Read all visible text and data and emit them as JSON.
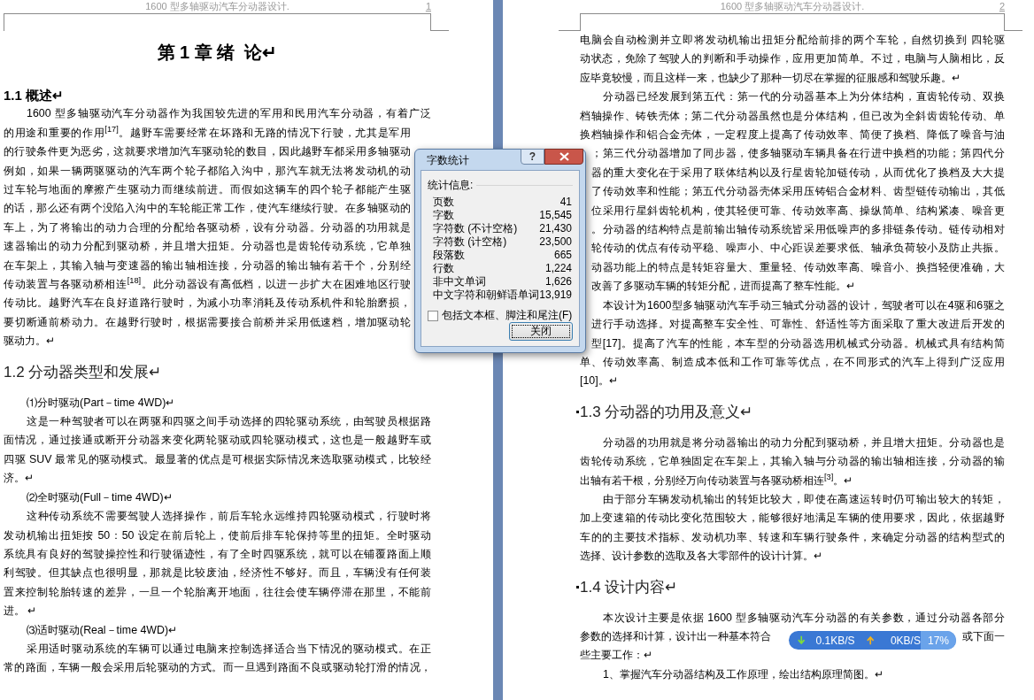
{
  "pages": [
    {
      "header": "1600 型多轴驱动汽车分动器设计.",
      "page_number": "1",
      "blocks": [
        {
          "kind": "chapter_title",
          "text": "第 1 章 绪  论↵"
        },
        {
          "kind": "section_title",
          "text": "1.1 概述↵"
        },
        {
          "kind": "first",
          "text": "1600 型多轴驱动汽车分动器作为我国较先进的军用和民用汽车分动器，有着广泛"
        },
        {
          "kind": "cut_end",
          "text": "的用途和重要的作用$^{[17]}$。越野车需要经常在坏路和无路的情况下行驶，尤其是军用"
        },
        {
          "kind": "cut_end",
          "text": "的行驶条件更为恶劣，这就要求增加汽车驱动轮的数目，因此越野车都采用多轴驱动"
        },
        {
          "kind": "cut_end",
          "text": "例如，如果一辆两驱驱动的汽车两个轮子都陷入沟中，那汽车就无法将发动机的动"
        },
        {
          "kind": "cut_end",
          "text": "过车轮与地面的摩擦产生驱动力而继续前进。而假如这辆车的四个轮子都能产生驱"
        },
        {
          "kind": "cut_end",
          "text": "的话，那么还有两个没陷入沟中的车轮能正常工作，使汽车继续行驶。在多轴驱动的"
        },
        {
          "kind": "cut_end",
          "text": "车上，为了将输出的动力合理的分配给各驱动桥，设有分动器。分动器的功用就是"
        },
        {
          "kind": "cut_end",
          "text": "速器输出的动力分配到驱动桥，并且增大扭矩。分动器也是齿轮传动系统，它单独"
        },
        {
          "kind": "cut_end",
          "text": "在车架上，其输入轴与变速器的输出轴相连接，分动器的输出轴有若干个，分别经"
        },
        {
          "kind": "cut_end",
          "text": "传动装置与各驱动桥相连$^{[18]}$。此分动器设有高低档，以进一步扩大在困难地区行驶"
        },
        {
          "kind": "cut_end",
          "text": "传动比。越野汽车在良好道路行驶时，为减小功率消耗及传动系机件和轮胎磨损，"
        },
        {
          "kind": "cut_end",
          "text": "要切断通前桥动力。在越野行驶时，根据需要接合前桥并采用低速档，增加驱动轮"
        },
        {
          "kind": "end",
          "text": "驱动力。↵"
        },
        {
          "kind": "heading",
          "text": "1.2 分动器类型和发展↵",
          "bullet": false
        },
        {
          "kind": "item",
          "text": "⑴分时驱动(Part－time 4WD)↵"
        },
        {
          "kind": "first",
          "text": "这是一种驾驶者可以在两驱和四驱之间手动选择的四轮驱动系统，由驾驶员根据路"
        },
        {
          "kind": "line",
          "text": "面情况，通过接通或断开分动器来变化两轮驱动或四轮驱动模式，这也是一般越野车或"
        },
        {
          "kind": "line",
          "text": "四驱 SUV 最常见的驱动模式。最显著的优点是可根据实际情况来选取驱动模式，比较经"
        },
        {
          "kind": "end",
          "text": "济。↵"
        },
        {
          "kind": "item",
          "text": "⑵全时驱动(Full－time 4WD)↵"
        },
        {
          "kind": "first",
          "text": "这种传动系统不需要驾驶人选择操作，前后车轮永远维持四轮驱动模式，行驶时将"
        },
        {
          "kind": "line",
          "text": "发动机输出扭矩按 50：50 设定在前后轮上，使前后排车轮保持等里的扭矩。全时驱动"
        },
        {
          "kind": "line",
          "text": "系统具有良好的驾驶操控性和行驶循迹性，有了全时四驱系统，就可以在铺覆路面上顺"
        },
        {
          "kind": "line",
          "text": "利驾驶。但其缺点也很明显，那就是比较废油，经济性不够好。而且，车辆没有任何装"
        },
        {
          "kind": "line",
          "text": "置来控制轮胎转速的差异，一旦一个轮胎离开地面，往往会使车辆停滞在那里，不能前"
        },
        {
          "kind": "end",
          "text": "进。 ↵"
        },
        {
          "kind": "item",
          "text": "⑶适时驱动(Real－time 4WD)↵"
        },
        {
          "kind": "first",
          "text": "采用适时驱动系统的车辆可以通过电脑来控制选择适合当下情况的驱动模式。在正"
        },
        {
          "kind": "line",
          "text": "常的路面，车辆一般会采用后轮驱动的方式。而一旦遇到路面不良或驱动轮打滑的情况，"
        }
      ]
    },
    {
      "header": "1600 型多轴驱动汽车分动器设计.",
      "page_number": "2",
      "blocks": [
        {
          "kind": "line",
          "text": "电脑会自动检测并立即将发动机输出扭矩分配给前排的两个车轮，自然切换到 四轮驱"
        },
        {
          "kind": "line",
          "text": "动状态，免除了驾驶人的判断和手动操作，应用更加简单。不过，电脑与人脑相比，反"
        },
        {
          "kind": "end",
          "text": "应毕竟较慢，而且这样一来，也缺少了那种一切尽在掌握的征服感和驾驶乐趣。↵"
        },
        {
          "kind": "first",
          "text": "分动器已经发展到第五代：第一代的分动器基本上为分体结构，直齿轮传动、双换"
        },
        {
          "kind": "line",
          "text": "档轴操作、铸铁壳体；第二代分动器虽然也是分体结构，但已改为全斜齿齿轮传动、单"
        },
        {
          "kind": "line",
          "text": "换档轴操作和铝合金壳体，一定程度上提高了传动效率、简便了换档、降低了噪音与油"
        },
        {
          "kind": "cut_start",
          "text": "；第三代分动器增加了同步器，使多轴驱动车辆具备在行进中换档的功能；第四代分"
        },
        {
          "kind": "cut_start",
          "text": "器的重大变化在于采用了联体结构以及行星齿轮加链传动，从而优化了换档及大大提"
        },
        {
          "kind": "cut_start",
          "text": "了传动效率和性能；第五代分动器壳体采用压铸铝合金材料、齿型链传动输出，其低"
        },
        {
          "kind": "cut_start",
          "text": "位采用行星斜齿轮机构，使其轻便可靠、传动效率高、操纵简单、结构紧凑、噪音更"
        },
        {
          "kind": "cut_start",
          "text": "。分动器的结构特点是前输出轴传动系统皆采用低噪声的多排链条传动。链传动相对"
        },
        {
          "kind": "cut_start",
          "text": "轮传动的优点有传动平稳、噪声小、中心距误差要求低、轴承负荷较小及防止共振。"
        },
        {
          "kind": "cut_start",
          "text": "动器功能上的特点是转矩容量大、重量轻、传动效率高、噪音小、换挡轻便准确，大"
        },
        {
          "kind": "cut_start_end",
          "text": "改善了多驱动车辆的转矩分配，进而提高了整车性能。↵"
        },
        {
          "kind": "first",
          "text": "本设计为1600型多轴驱动汽车手动三轴式分动器的设计，驾驶者可以在4驱和6驱之"
        },
        {
          "kind": "cut_start",
          "text": "进行手动选择。对提高整车安全性、可靠性、舒适性等方面采取了重大改进后开发的"
        },
        {
          "kind": "cut_start",
          "text": "型[17]。提高了汽车的性能，本车型的分动器选用机械式分动器。机械式具有结构简"
        },
        {
          "kind": "line",
          "text": "单、传动效率高、制造成本低和工作可靠等优点，在不同形式的汽车上得到广泛应用"
        },
        {
          "kind": "end",
          "text": "[10]。↵"
        },
        {
          "kind": "heading",
          "text": "1.3 分动器的功用及意义↵",
          "bullet": true
        },
        {
          "kind": "first",
          "text": "分动器的功用就是将分动器输出的动力分配到驱动桥，并且增大扭矩。分动器也是"
        },
        {
          "kind": "line",
          "text": "齿轮传动系统，它单独固定在车架上，其输入轴与分动器的输出轴相连接，分动器的输"
        },
        {
          "kind": "end",
          "text": "出轴有若干根，分别经万向传动装置与各驱动桥相连$^{[3]}$。↵"
        },
        {
          "kind": "first",
          "text": "由于部分车辆发动机输出的转矩比较大，即使在高速运转时仍可输出较大的转矩，"
        },
        {
          "kind": "line",
          "text": "加上变速箱的传动比变化范围较大，能够很好地满足车辆的使用要求，因此，依据越野"
        },
        {
          "kind": "line",
          "text": "车的的主要技术指标、发动机功率、转速和车辆行驶条件，来确定分动器的结构型式的"
        },
        {
          "kind": "end",
          "text": "选择、设计参数的选取及各大零部件的设计计算。↵"
        },
        {
          "kind": "heading",
          "text": "1.4 设计内容↵",
          "bullet": true
        },
        {
          "kind": "first",
          "text": "本次设计主要是依据 1600 型多轴驱动汽车分动器的有关参数，通过分动器各部分"
        },
        {
          "kind": "split",
          "parts": [
            "参数的选择和计算，设计出一种基本符合",
            "或下面一"
          ]
        },
        {
          "kind": "end",
          "text": "些主要工作：↵"
        },
        {
          "kind": "item",
          "text": "1、掌握汽车分动器结构及工作原理，绘出结构原理简图。↵"
        }
      ]
    }
  ],
  "word_count_dialog": {
    "title": "字数统计",
    "help_button": "?",
    "group_label": "统计信息:",
    "stats": [
      {
        "label": "页数",
        "value": "41"
      },
      {
        "label": "字数",
        "value": "15,545"
      },
      {
        "label": "字符数 (不计空格)",
        "value": "21,430"
      },
      {
        "label": "字符数 (计空格)",
        "value": "23,500"
      },
      {
        "label": "段落数",
        "value": "665"
      },
      {
        "label": "行数",
        "value": "1,224"
      },
      {
        "label": "非中文单词",
        "value": "1,626"
      },
      {
        "label": "中文字符和朝鲜语单词",
        "value": "13,919"
      }
    ],
    "include_checkbox": {
      "label": "包括文本框、脚注和尾注(F)",
      "checked": false
    },
    "close_button": "关闭"
  },
  "network_monitor": {
    "download": "0.1KB/S",
    "upload": "0KB/S",
    "cpu": "17%"
  }
}
